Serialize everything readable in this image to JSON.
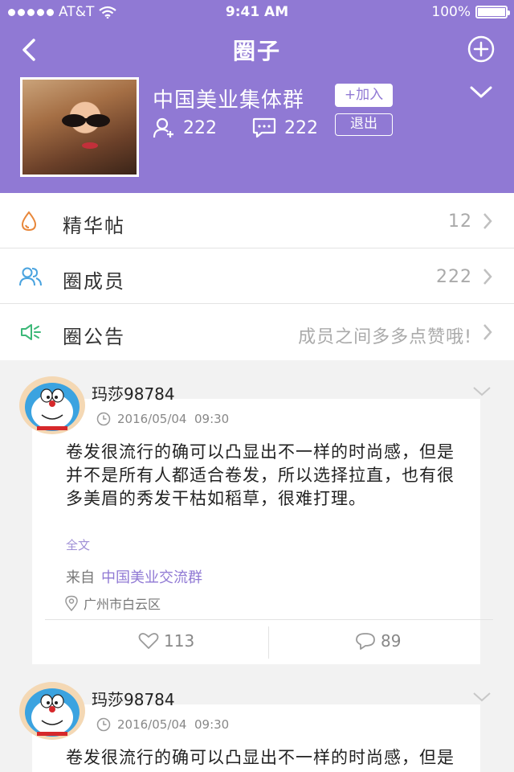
{
  "status_bar": {
    "carrier": "AT&T",
    "time": "9:41 AM",
    "battery": "100%",
    "battery_level": 1.0
  },
  "nav": {
    "title": "圈子",
    "back_icon": "chevron-left-icon",
    "add_icon": "plus-circle-icon"
  },
  "group": {
    "name": "中国美业集体群",
    "join_label": "+加入",
    "quit_label": "退出",
    "members_count": "222",
    "posts_count": "222"
  },
  "menu": {
    "items": [
      {
        "label": "精华帖",
        "value": "12",
        "icon": "drop-icon"
      },
      {
        "label": "圈成员",
        "value": "222",
        "icon": "members-icon"
      },
      {
        "label": "圈公告",
        "value": "成员之间多多点赞哦!",
        "icon": "speaker-icon"
      }
    ]
  },
  "posts": [
    {
      "author": "玛莎98784",
      "time": "2016/05/04  09:30",
      "body": "卷发很流行的确可以凸显出不一样的时尚感，但是并不是所有人都适合卷发，所以选择拉直，也有很多美眉的秀发干枯如稻草，很难打理。",
      "more_label": "全文",
      "from_label": "来自",
      "from_group": "中国美业交流群",
      "location": "广州市白云区",
      "likes": "113",
      "comments": "89"
    },
    {
      "author": "玛莎98784",
      "time": "2016/05/04  09:30",
      "body": "卷发很流行的确可以凸显出不一样的时尚感，但是并不是所有人都适合卷发，所以选择"
    }
  ],
  "colors": {
    "accent": "#9079d4",
    "link": "#9079d4",
    "drop_icon": "#e8873a",
    "members_icon": "#4aa3df",
    "speaker_icon": "#3cb878"
  }
}
